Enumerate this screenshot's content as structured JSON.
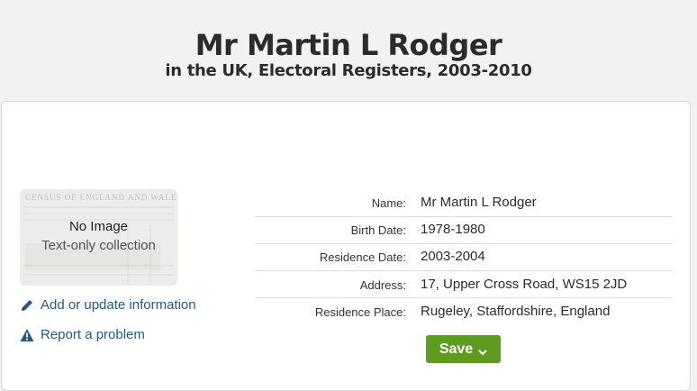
{
  "page": {
    "title": "Mr Martin L Rodger",
    "subtitle": "in the UK, Electoral Registers, 2003-2010"
  },
  "thumbnail": {
    "no_image": "No Image",
    "collection_note": "Text-only collection",
    "background_text": "CENSUS OF ENGLAND AND WALES"
  },
  "links": {
    "add_update": "Add or update information",
    "report": "Report a problem"
  },
  "record": [
    {
      "label": "Name:",
      "value": "Mr Martin L Rodger"
    },
    {
      "label": "Birth Date:",
      "value": "1978-1980"
    },
    {
      "label": "Residence Date:",
      "value": "2003-2004"
    },
    {
      "label": "Address:",
      "value": "17, Upper Cross Road, WS15 2JD"
    },
    {
      "label": "Residence Place:",
      "value": "Rugeley, Staffordshire, England"
    }
  ],
  "save": {
    "label": "Save"
  },
  "colors": {
    "link": "#255a7c",
    "save": "#5f9b1e"
  },
  "icons": {
    "edit": "pencil-icon",
    "report": "warning-icon",
    "save_menu": "chevron-down-icon"
  }
}
